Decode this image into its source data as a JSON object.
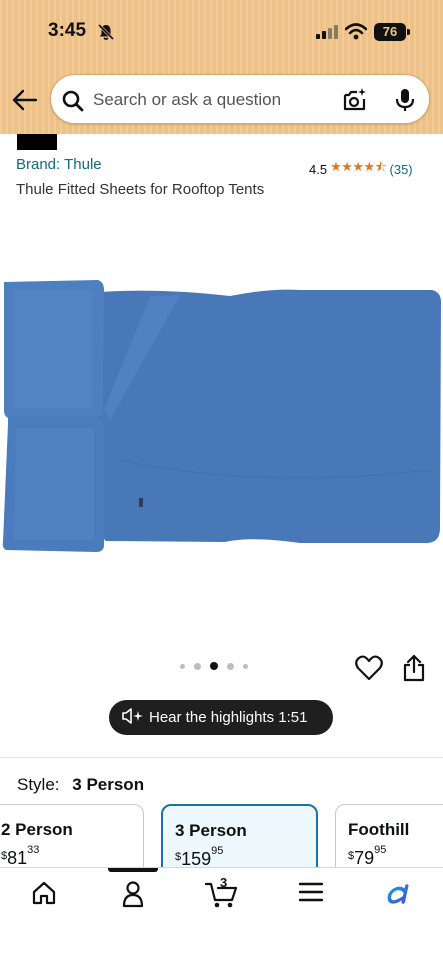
{
  "status_bar": {
    "time": "3:45",
    "battery": "76"
  },
  "search": {
    "placeholder": "Search or ask a question"
  },
  "product": {
    "brand": "Brand: Thule",
    "rating_value": "4.5",
    "stars": "★★★★⯪",
    "rating_count": "(35)",
    "title": "Thule Fitted Sheets for Rooftop Tents",
    "image_dots_total": 5,
    "image_dots_active_index": 2
  },
  "highlights": {
    "label": "Hear the highlights 1:51"
  },
  "style": {
    "label": "Style:",
    "selected": "3 Person",
    "options": [
      {
        "name": "2 Person",
        "currency": "$",
        "dollars": "81",
        "cents": "33"
      },
      {
        "name": "3 Person",
        "currency": "$",
        "dollars": "159",
        "cents": "95"
      },
      {
        "name": "Foothill",
        "currency": "$",
        "dollars": "79",
        "cents": "95"
      }
    ]
  },
  "bottom_nav": {
    "items": [
      "home-icon",
      "account-icon",
      "cart-icon",
      "menu-icon",
      "rufus-icon"
    ],
    "cart_count": "3",
    "active": "account-icon"
  },
  "colors": {
    "header": "#f3c68d",
    "link": "#0f6a82",
    "star": "#de7921",
    "sheet": "#4473b3",
    "selected_border": "#1f6fa8"
  }
}
